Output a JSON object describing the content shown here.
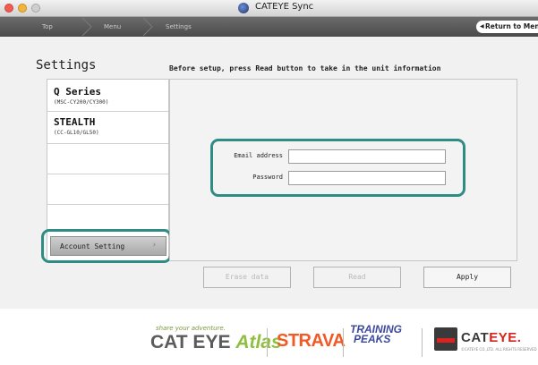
{
  "window": {
    "title": "CATEYE Sync"
  },
  "nav": {
    "crumbs": [
      "Top",
      "Menu",
      "Settings"
    ],
    "return_label": "Return to Menu"
  },
  "page": {
    "title": "Settings",
    "instruction": "Before setup, press Read button to take in the unit information"
  },
  "sidebar": {
    "items": [
      {
        "name": "Q Series",
        "model": "(MSC-CY200/CY300)"
      },
      {
        "name": "STEALTH",
        "model": "(CC-GL10/GL50)"
      }
    ],
    "account_button": "Account Setting"
  },
  "form": {
    "email_label": "Email address",
    "email_value": "",
    "password_label": "Password",
    "password_value": ""
  },
  "buttons": {
    "erase": "Erase data",
    "read": "Read",
    "apply": "Apply"
  },
  "footer": {
    "atlas_tagline": "share your adventure.",
    "atlas_brand": "CAT EYE",
    "atlas_name": "Atlas",
    "strava": "STRAVA",
    "trainingpeaks_line1": "TRAINING",
    "trainingpeaks_line2": "PEAKS",
    "cateye_cat": "CAT",
    "cateye_eye": "EYE.",
    "copyright": "©CATEYE CO.,LTD. ALL RIGHTS RESERVED"
  },
  "colors": {
    "highlight": "#2f8c84",
    "strava": "#f15a24",
    "cateye_red": "#d6231d",
    "atlas_green": "#8fbf3f"
  }
}
